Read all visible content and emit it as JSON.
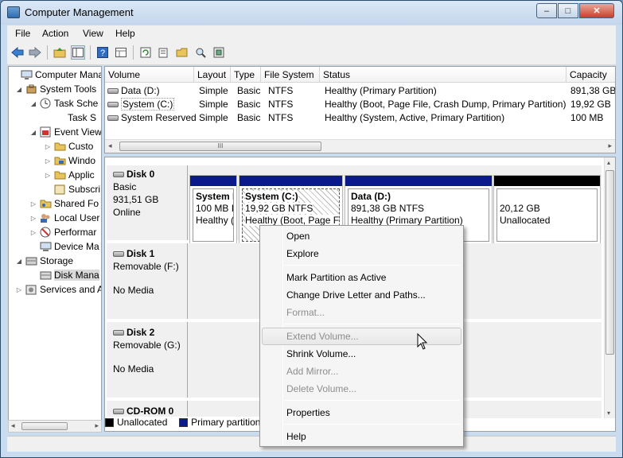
{
  "window": {
    "title": "Computer Management",
    "minimize": "–",
    "maximize": "□",
    "close": "✕"
  },
  "menu": [
    "File",
    "Action",
    "View",
    "Help"
  ],
  "toolbar": {
    "icons": [
      "back-arrow-icon",
      "forward-arrow-icon",
      "up-folder-icon",
      "show-hide-tree-icon",
      "help-icon",
      "properties-grid-icon",
      "refresh-icon",
      "export-list-icon",
      "open-folder-icon",
      "search-icon",
      "settings-icon"
    ]
  },
  "tree": {
    "items": [
      {
        "label": "Computer Manag",
        "expander": "",
        "indent": 0,
        "icon": "computer-icon"
      },
      {
        "label": "System Tools",
        "expander": "◢",
        "indent": 1,
        "icon": "tools-icon"
      },
      {
        "label": "Task Sche",
        "expander": "◢",
        "indent": 2,
        "icon": "clock-icon"
      },
      {
        "label": "Task S",
        "expander": "",
        "indent": 3,
        "icon": ""
      },
      {
        "label": "Event View",
        "expander": "◢",
        "indent": 2,
        "icon": "event-viewer-icon"
      },
      {
        "label": "Custo",
        "expander": "▷",
        "indent": 3,
        "icon": "folder-icon"
      },
      {
        "label": "Windo",
        "expander": "▷",
        "indent": 3,
        "icon": "folder-icon"
      },
      {
        "label": "Applic",
        "expander": "▷",
        "indent": 3,
        "icon": "folder-icon"
      },
      {
        "label": "Subscri",
        "expander": "",
        "indent": 3,
        "icon": "subscriptions-icon"
      },
      {
        "label": "Shared Fo",
        "expander": "▷",
        "indent": 2,
        "icon": "shared-folder-icon"
      },
      {
        "label": "Local User",
        "expander": "▷",
        "indent": 2,
        "icon": "users-icon"
      },
      {
        "label": "Performar",
        "expander": "▷",
        "indent": 2,
        "icon": "performance-icon"
      },
      {
        "label": "Device Ma",
        "expander": "",
        "indent": 2,
        "icon": "device-manager-icon"
      },
      {
        "label": "Storage",
        "expander": "◢",
        "indent": 1,
        "icon": "storage-icon"
      },
      {
        "label": "Disk Mana",
        "expander": "",
        "indent": 2,
        "icon": "disk-management-icon",
        "selected": true
      },
      {
        "label": "Services and A",
        "expander": "▷",
        "indent": 1,
        "icon": "services-icon"
      }
    ]
  },
  "volumes": {
    "columns": [
      "Volume",
      "Layout",
      "Type",
      "File System",
      "Status",
      "Capacity"
    ],
    "rows": [
      [
        "Data (D:)",
        "Simple",
        "Basic",
        "NTFS",
        "Healthy (Primary Partition)",
        "891,38 GB"
      ],
      [
        "System (C:)",
        "Simple",
        "Basic",
        "NTFS",
        "Healthy (Boot, Page File, Crash Dump, Primary Partition)",
        "19,92 GB"
      ],
      [
        "System Reserved",
        "Simple",
        "Basic",
        "NTFS",
        "Healthy (System, Active, Primary Partition)",
        "100 MB"
      ]
    ],
    "scroll_thumb": "III"
  },
  "disks": [
    {
      "name": "Disk 0",
      "lines": [
        "Basic",
        "931,51 GB",
        "Online"
      ]
    },
    {
      "name": "Disk 1",
      "lines": [
        "Removable (F:)",
        "",
        "No Media"
      ]
    },
    {
      "name": "Disk 2",
      "lines": [
        "Removable (G:)",
        "",
        "No Media"
      ]
    },
    {
      "name": "CD-ROM 0",
      "lines": []
    }
  ],
  "partitions": [
    {
      "title": "System I",
      "size": "100 MB I",
      "status": "Healthy (",
      "color": "#0a1a8a"
    },
    {
      "title": "System  (C:)",
      "size": "19,92 GB NTFS",
      "status": "Healthy (Boot, Page Fi",
      "color": "#0a1a8a"
    },
    {
      "title": "Data  (D:)",
      "size": "891,38 GB NTFS",
      "status": "Healthy (Primary Partition)",
      "color": "#0a1a8a"
    },
    {
      "title": "",
      "size": "20,12 GB",
      "status": "Unallocated",
      "color": "#000000"
    }
  ],
  "legend": {
    "unallocated": "Unallocated",
    "primary": "Primary partition",
    "unallocated_color": "#000000",
    "primary_color": "#0a1a8a"
  },
  "context_menu": {
    "items": [
      {
        "label": "Open",
        "disabled": false
      },
      {
        "label": "Explore",
        "disabled": false
      },
      {
        "label": "Mark Partition as Active",
        "disabled": false
      },
      {
        "label": "Change Drive Letter and Paths...",
        "disabled": false
      },
      {
        "label": "Format...",
        "disabled": true
      },
      {
        "label": "Extend Volume...",
        "disabled": true,
        "hover": true
      },
      {
        "label": "Shrink Volume...",
        "disabled": false
      },
      {
        "label": "Add Mirror...",
        "disabled": true
      },
      {
        "label": "Delete Volume...",
        "disabled": true
      },
      {
        "label": "Properties",
        "disabled": false
      },
      {
        "label": "Help",
        "disabled": false
      }
    ]
  }
}
